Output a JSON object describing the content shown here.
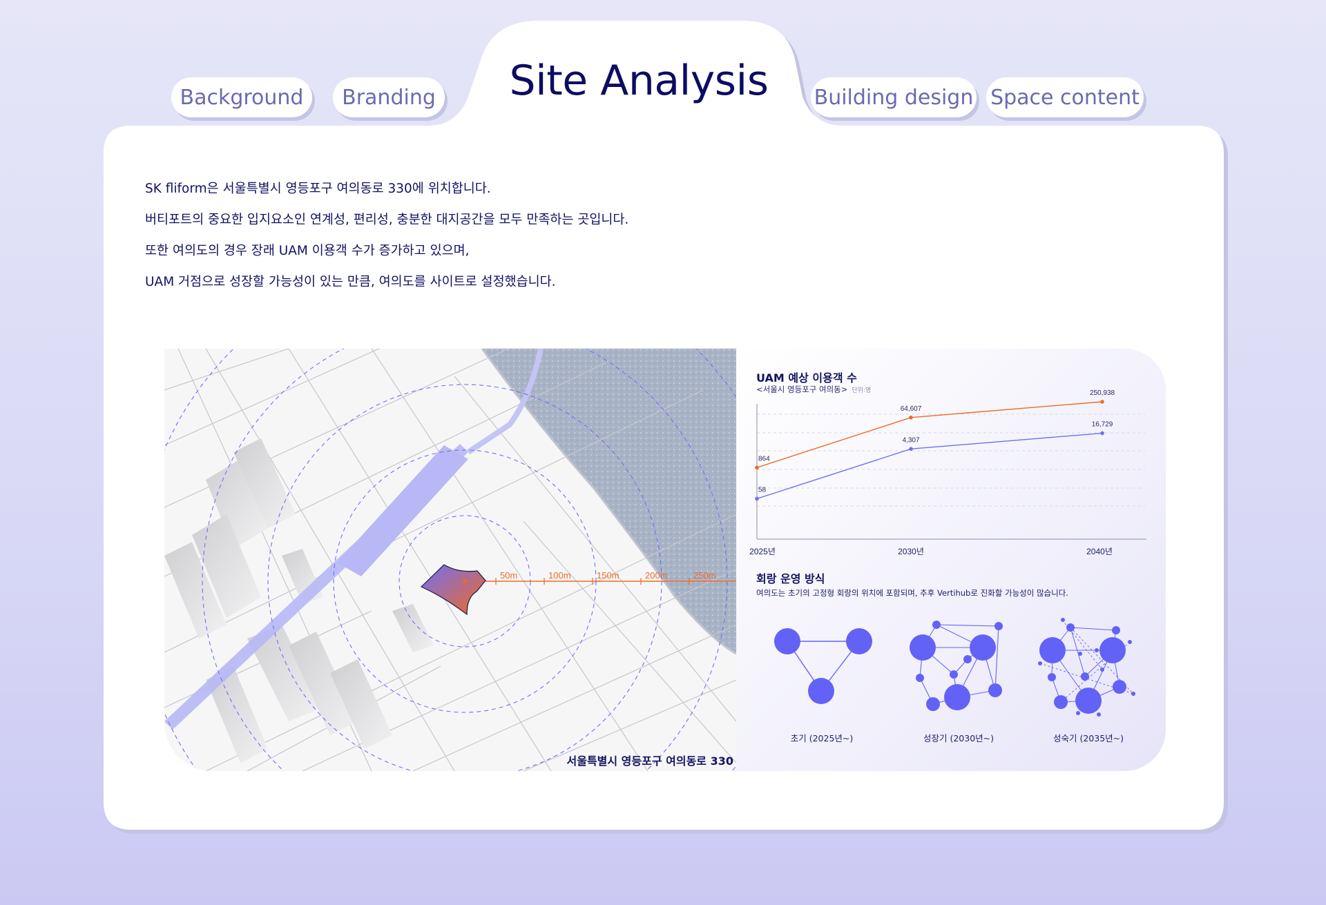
{
  "nav": {
    "tabs": [
      {
        "label": "Background"
      },
      {
        "label": "Branding"
      },
      {
        "label": "Building design"
      },
      {
        "label": "Space content"
      }
    ],
    "active_tab": "Site Analysis"
  },
  "intro": {
    "lines": [
      "SK fliform은 서울특별시 영등포구 여의동로 330에 위치합니다.",
      "버티포트의 중요한 입지요소인 연계성, 편리성, 충분한 대지공간을 모두 만족하는 곳입니다.",
      "또한 여의도의 경우 장래 UAM 이용객 수가 증가하고 있으며,",
      "UAM 거점으로 성장할 가능성이 있는 만큼, 여의도를 사이트로 설정했습니다."
    ]
  },
  "map": {
    "address": "서울특별시 영등포구 여의동로 330",
    "distance_labels": [
      "50m",
      "100m",
      "150m",
      "200m",
      "250m"
    ],
    "accent_color": "#f06a24",
    "ring_color": "#6f6ff5"
  },
  "chart_data": {
    "type": "line",
    "title": "UAM 예상 이용객 수",
    "subtitle": "<서울시 영등포구 여의동>",
    "unit": "단위:명",
    "categories": [
      "2025년",
      "2030년",
      "2040년"
    ],
    "series": [
      {
        "values": [
          864,
          64607,
          250938
        ],
        "labels": [
          "864",
          "64,607",
          "250,938"
        ],
        "color": "#f06a24"
      },
      {
        "values": [
          58,
          4307,
          16729
        ],
        "labels": [
          "58",
          "4,307",
          "16,729"
        ],
        "color": "#6f6ff5"
      }
    ]
  },
  "corridor": {
    "title": "회랑 운영 방식",
    "description": "여의도는 초기의 고정형 회랑의 위치에 포함되며, 추후 Vertihub로 진화할 가능성이 많습니다.",
    "stages": [
      {
        "label": "초기 (2025년~)"
      },
      {
        "label": "성장기 (2030년~)"
      },
      {
        "label": "성숙기 (2035년~)"
      }
    ],
    "node_color": "#6262f6"
  }
}
